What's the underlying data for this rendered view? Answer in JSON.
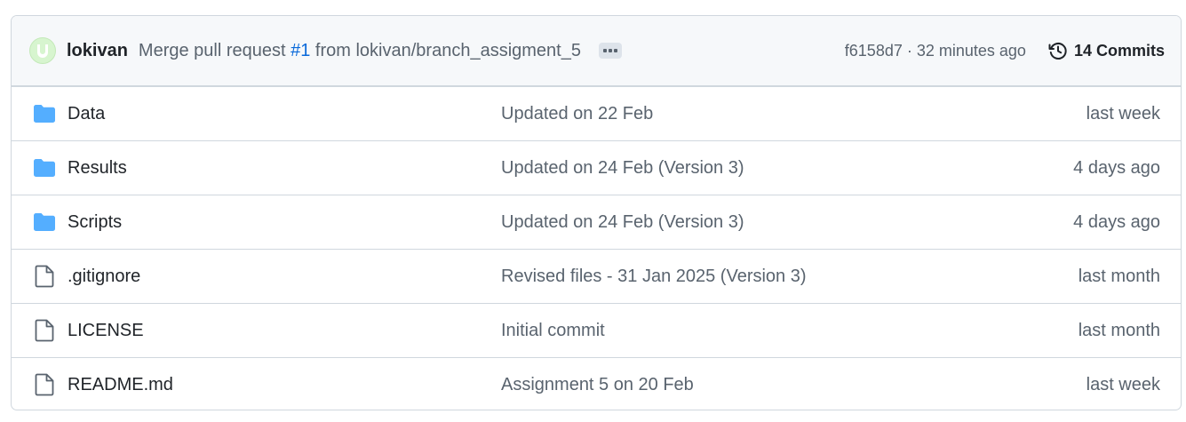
{
  "header": {
    "author": "lokivan",
    "commit_message_prefix": "Merge pull request ",
    "pr_number": "#1",
    "commit_message_suffix": " from lokivan/branch_assigment_5",
    "commit_hash": "f6158d7",
    "separator": " · ",
    "commit_time": "32 minutes ago",
    "commits_label": "14 Commits",
    "avatar_color": "#d7f5cf",
    "link_color": "#0969da"
  },
  "files": [
    {
      "icon": "folder-icon",
      "name": "Data",
      "commit": "Updated on 22 Feb",
      "time": "last week"
    },
    {
      "icon": "folder-icon",
      "name": "Results",
      "commit": "Updated on 24 Feb (Version 3)",
      "time": "4 days ago"
    },
    {
      "icon": "folder-icon",
      "name": "Scripts",
      "commit": "Updated on 24 Feb (Version 3)",
      "time": "4 days ago"
    },
    {
      "icon": "file-icon",
      "name": ".gitignore",
      "commit": "Revised files - 31 Jan 2025 (Version 3)",
      "time": "last month"
    },
    {
      "icon": "file-icon",
      "name": "LICENSE",
      "commit": "Initial commit",
      "time": "last month"
    },
    {
      "icon": "file-icon",
      "name": "README.md",
      "commit": "Assignment 5 on 20 Feb",
      "time": "last week"
    }
  ],
  "colors": {
    "folder": "#54aeff",
    "file_outline": "#59636e",
    "border": "#d0d7de",
    "header_bg": "#f6f8fa"
  }
}
